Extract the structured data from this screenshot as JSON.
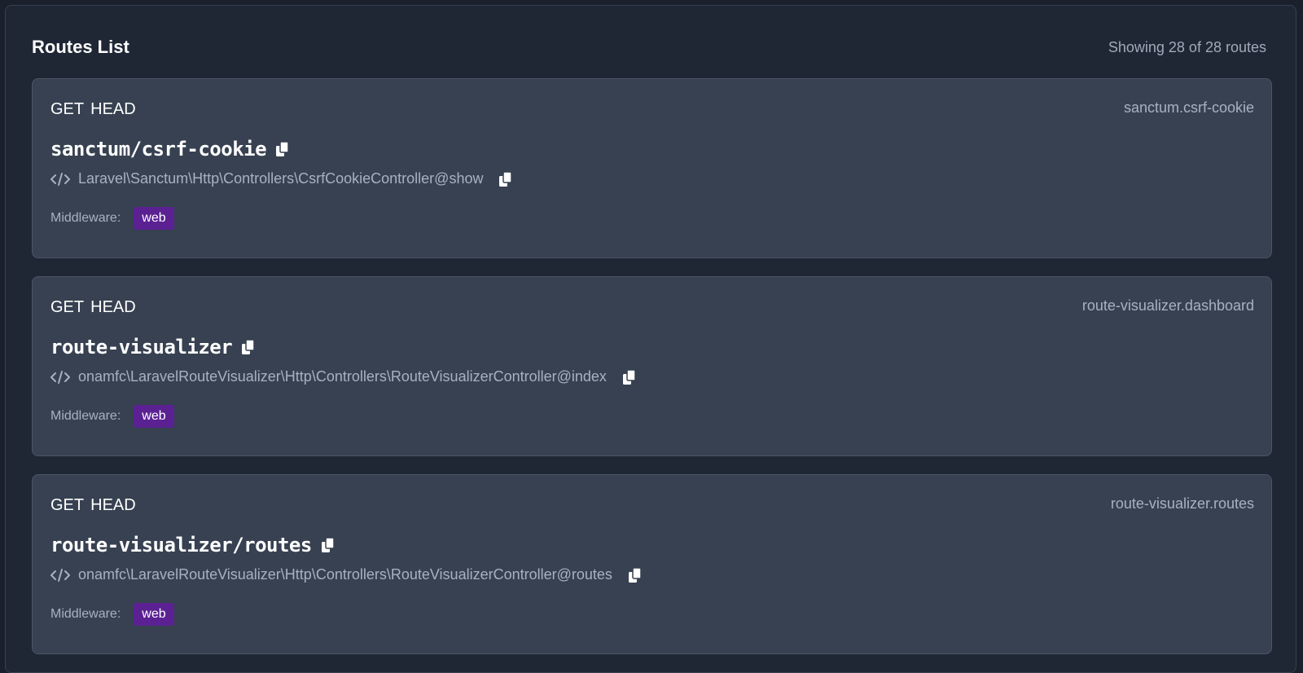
{
  "header": {
    "title": "Routes List",
    "count_text": "Showing 28 of 28 routes"
  },
  "icons": {
    "copy": "copy-icon",
    "code": "code-icon"
  },
  "colors": {
    "middleware_badge": "#5b2193",
    "card_bg": "#374151",
    "page_bg": "#1f2735"
  },
  "routes": [
    {
      "methods": [
        "GET",
        "HEAD"
      ],
      "name": "sanctum.csrf-cookie",
      "uri": "sanctum/csrf-cookie",
      "action": "Laravel\\Sanctum\\Http\\Controllers\\CsrfCookieController@show",
      "middleware_label": "Middleware:",
      "middleware": [
        "web"
      ]
    },
    {
      "methods": [
        "GET",
        "HEAD"
      ],
      "name": "route-visualizer.dashboard",
      "uri": "route-visualizer",
      "action": "onamfc\\LaravelRouteVisualizer\\Http\\Controllers\\RouteVisualizerController@index",
      "middleware_label": "Middleware:",
      "middleware": [
        "web"
      ]
    },
    {
      "methods": [
        "GET",
        "HEAD"
      ],
      "name": "route-visualizer.routes",
      "uri": "route-visualizer/routes",
      "action": "onamfc\\LaravelRouteVisualizer\\Http\\Controllers\\RouteVisualizerController@routes",
      "middleware_label": "Middleware:",
      "middleware": [
        "web"
      ]
    }
  ]
}
